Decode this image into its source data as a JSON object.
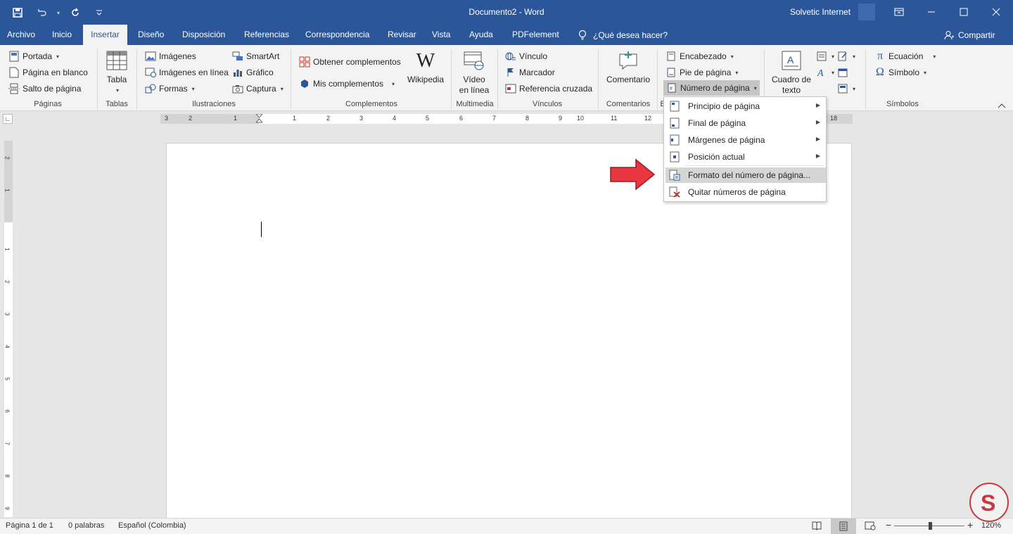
{
  "window": {
    "title": "Documento2  -  Word",
    "user": "Solvetic Internet"
  },
  "tabs": [
    "Archivo",
    "Inicio",
    "Insertar",
    "Diseño",
    "Disposición",
    "Referencias",
    "Correspondencia",
    "Revisar",
    "Vista",
    "Ayuda",
    "PDFelement"
  ],
  "active_tab": "Insertar",
  "tell_me": "¿Qué desea hacer?",
  "share": "Compartir",
  "ribbon": {
    "paginas": {
      "label": "Páginas",
      "portada": "Portada",
      "blank": "Página en blanco",
      "break": "Salto de página"
    },
    "tablas": {
      "label": "Tablas",
      "tabla": "Tabla"
    },
    "ilustraciones": {
      "label": "Ilustraciones",
      "imagenes": "Imágenes",
      "imagenes_linea": "Imágenes en línea",
      "formas": "Formas",
      "smartart": "SmartArt",
      "grafico": "Gráfico",
      "captura": "Captura"
    },
    "complementos": {
      "label": "Complementos",
      "obtener": "Obtener complementos",
      "mis": "Mis complementos",
      "wikipedia": "Wikipedia"
    },
    "multimedia": {
      "label": "Multimedia",
      "video1": "Vídeo",
      "video2": "en línea"
    },
    "vinculos": {
      "label": "Vínculos",
      "vinculo": "Vínculo",
      "marcador": "Marcador",
      "referencia": "Referencia cruzada"
    },
    "comentarios": {
      "label": "Comentarios",
      "comentario": "Comentario"
    },
    "encabezado": {
      "label": "E",
      "encabezado": "Encabezado",
      "pie": "Pie de página",
      "numero": "Número de página"
    },
    "texto": {
      "cuadro1": "Cuadro de",
      "cuadro2": "texto"
    },
    "simbolos": {
      "label": "Símbolos",
      "ecuacion": "Ecuación",
      "simbolo": "Símbolo"
    }
  },
  "ruler": {
    "h": [
      "3",
      "2",
      "1",
      "1",
      "2",
      "3",
      "4",
      "5",
      "6",
      "7",
      "8",
      "9",
      "10",
      "11",
      "12",
      "18"
    ],
    "v": [
      "2",
      "1",
      "1",
      "2",
      "3",
      "4",
      "5",
      "6",
      "7",
      "8",
      "9"
    ]
  },
  "dropdown": {
    "items": [
      {
        "label": "Principio de página",
        "submenu": true
      },
      {
        "label": "Final de página",
        "submenu": true
      },
      {
        "label": "Márgenes de página",
        "submenu": true
      },
      {
        "label": "Posición actual",
        "submenu": true
      },
      {
        "label": "Formato del número de página...",
        "submenu": false,
        "highlighted": true
      },
      {
        "label": "Quitar números de página",
        "submenu": false
      }
    ]
  },
  "status": {
    "page": "Página 1 de 1",
    "words": "0 palabras",
    "language": "Español (Colombia)",
    "zoom": "120%"
  },
  "colors": {
    "brand": "#2b579a",
    "arrow": "#e8373f"
  }
}
